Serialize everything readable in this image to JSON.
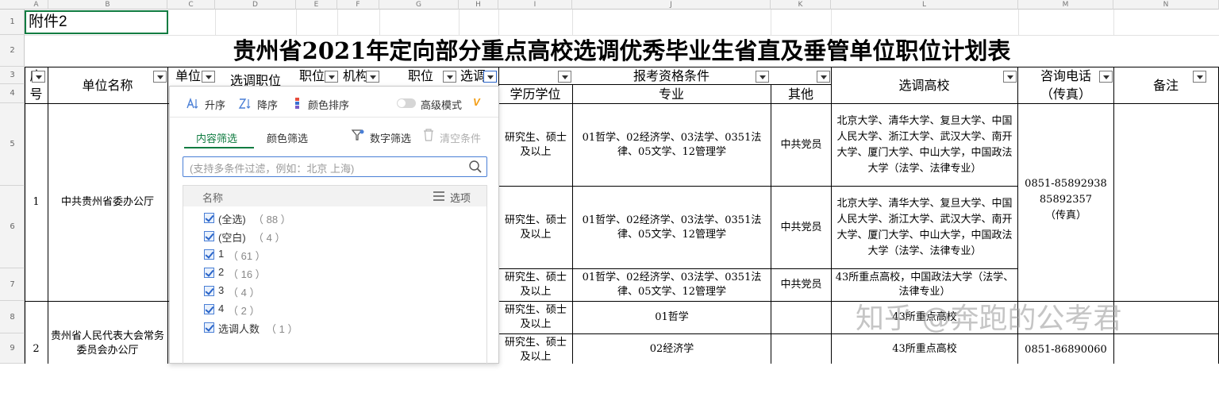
{
  "column_headers": [
    "A",
    "B",
    "C",
    "D",
    "E",
    "F",
    "G",
    "H",
    "I",
    "J",
    "K",
    "L",
    "M",
    "N"
  ],
  "row_headers": [
    "1",
    "2",
    "3",
    "4",
    "5",
    "6",
    "7",
    "8",
    "9"
  ],
  "cell_a1": "附件2",
  "title": "贵州省2021年定向部分重点高校选调优秀毕业生省直及垂管单位职位计划表",
  "headers": {
    "seq_top": "序",
    "seq_bottom": "号",
    "unit_name": "单位名称",
    "unit_code": "单位",
    "select_pos": "选调职位",
    "pos_code": "职位",
    "org": "机构",
    "position": "职位",
    "quota": "选调",
    "requirements": "报考资格条件",
    "degree": "学历学位",
    "major": "专业",
    "other": "其他",
    "schools": "选调高校",
    "phone_top": "咨询电话",
    "phone_bottom": "（传真）",
    "remark": "备注"
  },
  "rows": {
    "r5": {
      "degree": "研究生、硕士及以上",
      "major": "01哲学、02经济学、03法学、0351法律、05文学、12管理学",
      "other": "中共党员",
      "schools": "北京大学、清华大学、复旦大学、中国人民大学、浙江大学、武汉大学、南开大学、厦门大学、中山大学，中国政法大学（法学、法律专业）"
    },
    "r6": {
      "degree": "研究生、硕士及以上",
      "major": "01哲学、02经济学、03法学、0351法律、05文学、12管理学",
      "other": "中共党员",
      "schools": "北京大学、清华大学、复旦大学、中国人民大学、浙江大学、武汉大学、南开大学、厦门大学、中山大学，中国政法大学（法学、法律专业）"
    },
    "r7": {
      "degree": "研究生、硕士及以上",
      "major": "01哲学、02经济学、03法学、0351法律、05文学、12管理学",
      "other": "中共党员",
      "schools": "43所重点高校，中国政法大学（法学、法律专业）"
    },
    "r8": {
      "degree": "研究生、硕士及以上",
      "major": "01哲学",
      "other": "",
      "schools": "43所重点高校"
    },
    "r9": {
      "degree": "研究生、硕士及以上",
      "major": "02经济学",
      "other": "",
      "schools": "43所重点高校"
    }
  },
  "unit1": {
    "seq": "1",
    "name": "中共贵州省委办公厅",
    "phone1": "0851-85892938",
    "phone2": "85892357",
    "phone3": "（传真）"
  },
  "unit2": {
    "seq": "2",
    "name": "贵州省人民代表大会常务委员会办公厅",
    "phone": "0851-86890060"
  },
  "filter_panel": {
    "sort_asc": "升序",
    "sort_desc": "降序",
    "sort_color": "颜色排序",
    "advanced_mode": "高级模式",
    "tab_content": "内容筛选",
    "tab_color": "颜色筛选",
    "number_filter": "数字筛选",
    "clear": "清空条件",
    "search_placeholder": "(支持多条件过滤，例如：北京 上海)",
    "list_header": "名称",
    "options_label": "选项",
    "items": [
      {
        "label": "(全选)",
        "count": "（ 88 ）"
      },
      {
        "label": "(空白)",
        "count": "（ 4 ）"
      },
      {
        "label": "1",
        "count": "（ 61 ）"
      },
      {
        "label": "2",
        "count": "（ 16 ）"
      },
      {
        "label": "3",
        "count": "（ 4 ）"
      },
      {
        "label": "4",
        "count": "（ 2 ）"
      },
      {
        "label": "选调人数",
        "count": "（ 1 ）"
      }
    ]
  },
  "watermark": "知乎 @奔跑的公考君",
  "colors": {
    "accent_green": "#107c41",
    "checkbox_blue": "#2a64c8",
    "vip_orange": "#f39c12"
  }
}
